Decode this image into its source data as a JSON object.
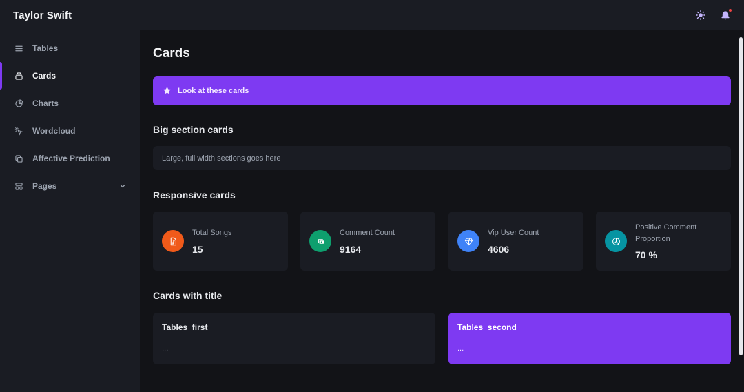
{
  "app": {
    "title": "Taylor Swift"
  },
  "sidebar": {
    "items": [
      {
        "label": "Tables",
        "icon": "table-icon"
      },
      {
        "label": "Cards",
        "icon": "cards-icon",
        "active": true
      },
      {
        "label": "Charts",
        "icon": "chart-icon"
      },
      {
        "label": "Wordcloud",
        "icon": "cursor-click-icon"
      },
      {
        "label": "Affective Prediction",
        "icon": "copy-icon"
      },
      {
        "label": "Pages",
        "icon": "pages-icon",
        "has_submenu": true
      }
    ]
  },
  "main": {
    "page_title": "Cards",
    "banner": {
      "text": "Look at these cards",
      "icon": "star-icon"
    },
    "big_section": {
      "title": "Big section cards",
      "body": "Large, full width sections goes here"
    },
    "responsive": {
      "title": "Responsive cards",
      "cards": [
        {
          "label": "Total Songs",
          "value": "15",
          "icon": "music-file-icon",
          "color": "#f05a1a"
        },
        {
          "label": "Comment Count",
          "value": "9164",
          "icon": "cash-icon",
          "color": "#0e9f6e"
        },
        {
          "label": "Vip User Count",
          "value": "4606",
          "icon": "diamond-icon",
          "color": "#3f83f8"
        },
        {
          "label": "Positive Comment Proportion",
          "value": "70 %",
          "icon": "pie-chart-icon",
          "color": "#0694a2"
        }
      ]
    },
    "titled": {
      "title": "Cards with title",
      "cards": [
        {
          "title": "Tables_first",
          "body": "...",
          "bg": "#1a1c23"
        },
        {
          "title": "Tables_second",
          "body": "...",
          "bg": "#7e3af2"
        }
      ]
    }
  },
  "colors": {
    "accent": "#7e3af2",
    "background": "#121317",
    "surface": "#1a1c23",
    "notification": "#ef4444"
  }
}
